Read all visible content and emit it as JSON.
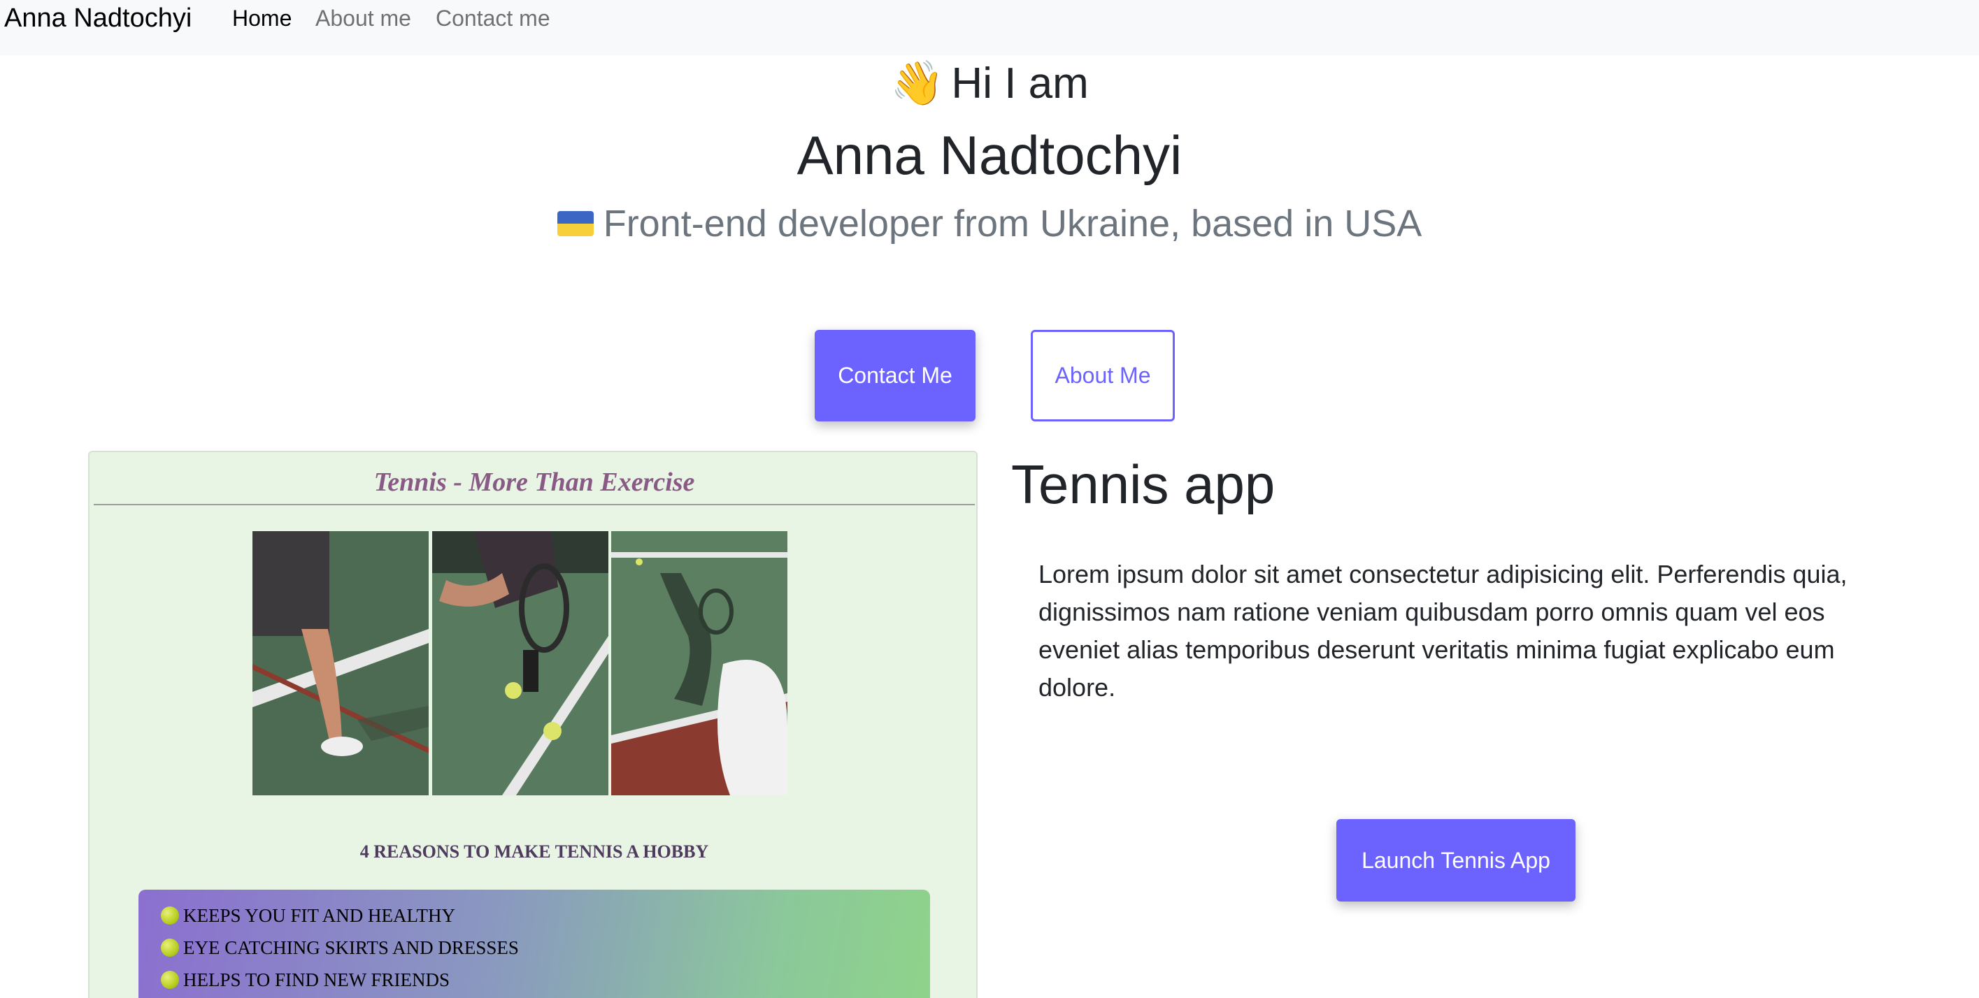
{
  "navbar": {
    "brand": "Anna Nadtochyi",
    "links": [
      {
        "label": "Home",
        "active": true
      },
      {
        "label": "About me",
        "active": false
      },
      {
        "label": "Contact me",
        "active": false
      }
    ]
  },
  "hero": {
    "wave_icon": "👋",
    "greeting": "Hi I am",
    "name": "Anna Nadtochyi",
    "flag_icon": "ukraine-flag-icon",
    "subtitle": "Front-end developer from Ukraine, based in USA",
    "contact_button": "Contact Me",
    "about_button": "About Me"
  },
  "tennis_card": {
    "title": "Tennis - More Than Exercise",
    "reasons_heading": "4 REASONS TO MAKE TENNIS A HOBBY",
    "reasons": [
      "KEEPS YOU FIT AND HEALTHY",
      "EYE CATCHING SKIRTS AND DRESSES",
      "HELPS TO FIND NEW FRIENDS"
    ]
  },
  "project": {
    "title": "Tennis app",
    "description": "Lorem ipsum dolor sit amet consectetur adipisicing elit. Perferendis quia, dignissimos nam ratione veniam quibusdam porro omnis quam vel eos eveniet alias temporibus deserunt veritatis minima fugiat explicabo eum dolore.",
    "launch_button": "Launch Tennis App"
  },
  "colors": {
    "primary": "#6c63ff",
    "navbar_bg": "#f8f9fa",
    "card_bg": "#e8f5e4",
    "card_title": "#8a5a86"
  }
}
